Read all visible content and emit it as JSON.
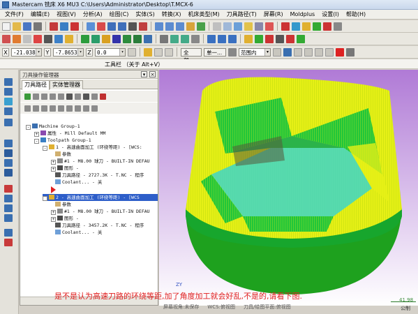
{
  "window": {
    "title": "Mastercam 铣床 X6 MU3  C:\\Users\\Administrator\\Desktop\\T.MCX-6"
  },
  "menu": [
    "文件(F)",
    "编辑(E)",
    "视图(V)",
    "分析(A)",
    "绘图(C)",
    "实体(S)",
    "转换(X)",
    "机床类型(M)",
    "刀具路径(T)",
    "屏幕(R)",
    "Moldplus",
    "设置(I)",
    "帮助(H)"
  ],
  "coords": {
    "x_label": "X",
    "x_value": "-21.0387",
    "y_label": "Y",
    "y_value": "-7.86536",
    "z_label": "Z",
    "z_value": "0.0",
    "level_button": "全部...",
    "single_button": "单一...",
    "range_select": "范围内"
  },
  "toolstrip": {
    "label": "工具栏    （关于 Alt+V）"
  },
  "panel": {
    "header": "刀具操作管理器",
    "tab_toolpaths": "刀具路径",
    "tab_solids": "实体管理器",
    "tree": [
      "Machine Group-1",
      "属性 - Mill Default MM",
      "Toolpath Group-1",
      "1 - 高速曲面加工 (环绕等距) - [WCS:",
      "参数",
      "#1 - M8.00 球刀 - BUILT-IN DEFAU",
      "图形 -",
      "刀具路径 - 2727.3K - T.NC - 程序",
      "Coolant... - 关",
      "2 - 高速曲面加工 (环绕等距) - [WCS",
      "参数",
      "#1 - M8.00 球刀 - BUILT-IN DEFAU",
      "图形 -",
      "刀具路径 - 3457.2K - T.NC - 程序",
      "Coolant... - 关"
    ]
  },
  "viewport": {
    "status": [
      "屏幕视角:未保存",
      "WCS:俯视图",
      "刀具/绘图平面:俯视图"
    ],
    "scale_value": "41.98",
    "bottom_right": "公制",
    "axis_label": "ZY",
    "caption": "是不是认为高速刀路的环绕等距,加了角度加工就会好乱,不是的,请看下图."
  },
  "colors": {
    "selection": "#2d5ec9",
    "caption": "#e02020",
    "toolpath_yellow": "#e6f016",
    "toolpath_green": "#1ea11e"
  }
}
